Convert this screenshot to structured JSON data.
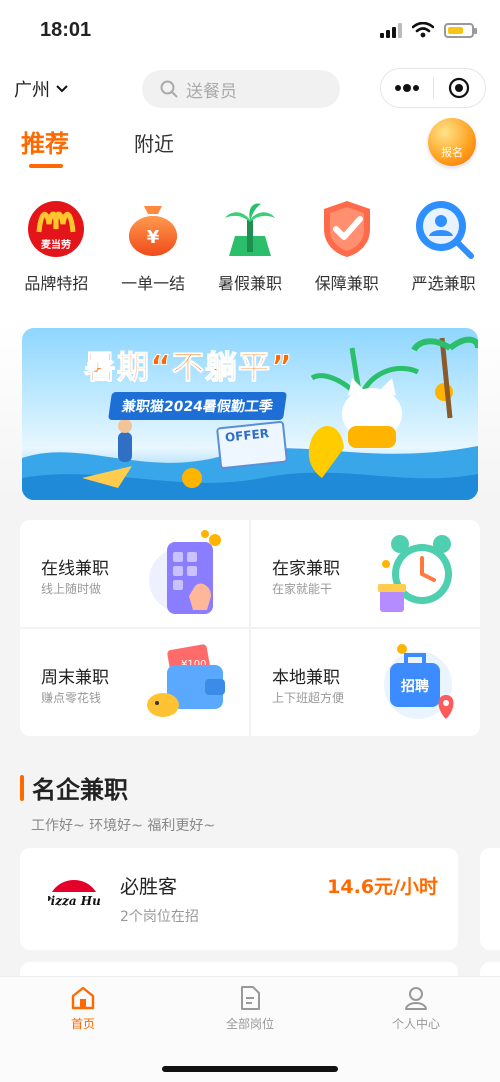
{
  "status_bar": {
    "time": "18:01"
  },
  "nav": {
    "city": "广州",
    "search_placeholder": "送餐员"
  },
  "tabs": [
    {
      "label": "推荐",
      "active": true
    },
    {
      "label": "附近",
      "active": false
    }
  ],
  "signup_badge": "报名",
  "categories": [
    {
      "label": "品牌特招",
      "icon": "mcdonalds-icon",
      "icon_text": "麦当劳"
    },
    {
      "label": "一单一结",
      "icon": "money-bag-icon",
      "icon_text": "¥"
    },
    {
      "label": "暑假兼职",
      "icon": "palm-tree-icon"
    },
    {
      "label": "保障兼职",
      "icon": "shield-check-icon"
    },
    {
      "label": "严选兼职",
      "icon": "person-search-icon"
    }
  ],
  "banner": {
    "headline": "暑期“不躺平”",
    "subline": "兼职猫2024暑假勤工季",
    "offer_text": "OFFER"
  },
  "job_types": [
    {
      "title": "在线兼职",
      "subtitle": "线上随时做",
      "icon": "phone-tap-icon"
    },
    {
      "title": "在家兼职",
      "subtitle": "在家就能干",
      "icon": "alarm-clock-icon"
    },
    {
      "title": "周末兼职",
      "subtitle": "赚点零花钱",
      "icon": "wallet-icon",
      "art_text": "¥100"
    },
    {
      "title": "本地兼职",
      "subtitle": "上下班超方便",
      "icon": "recruit-bag-icon",
      "art_text": "招聘"
    }
  ],
  "section": {
    "title": "名企兼职",
    "subtitle": "工作好~ 环境好~ 福利更好~"
  },
  "company": {
    "name": "必胜客",
    "positions": "2个岗位在招",
    "wage": "14.6元/小时",
    "logo": "pizza-hut-logo",
    "logo_text": "Pizza Hut"
  },
  "tabbar": [
    {
      "label": "首页",
      "icon": "home-icon",
      "active": true
    },
    {
      "label": "全部岗位",
      "icon": "document-icon",
      "active": false
    },
    {
      "label": "个人中心",
      "icon": "user-icon",
      "active": false
    }
  ],
  "colors": {
    "accent": "#ff6a00",
    "background": "#f4f4f4"
  }
}
